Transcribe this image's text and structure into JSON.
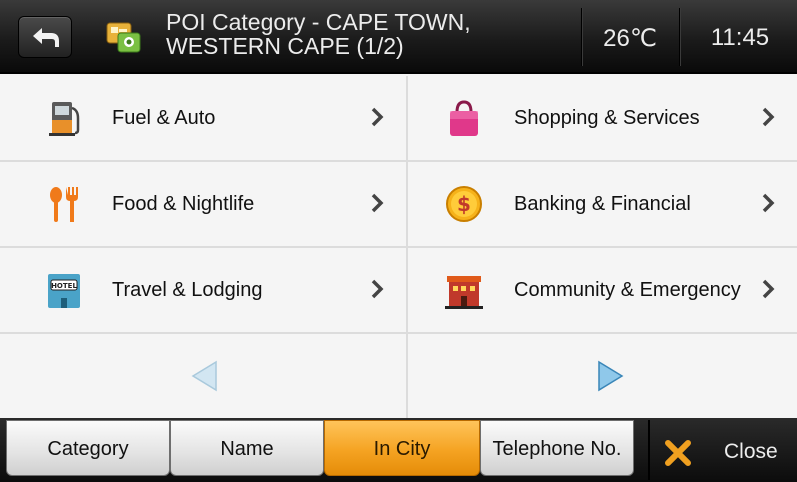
{
  "header": {
    "title_line1": "POI Category - CAPE TOWN,",
    "title_line2": "WESTERN CAPE (1/2)",
    "temperature": "26℃",
    "time": "11:45"
  },
  "categories": [
    {
      "label": "Fuel & Auto",
      "icon": "fuel-pump-icon"
    },
    {
      "label": "Shopping & Services",
      "icon": "shopping-bag-icon"
    },
    {
      "label": "Food & Nightlife",
      "icon": "fork-spoon-icon"
    },
    {
      "label": "Banking & Financial",
      "icon": "dollar-coin-icon"
    },
    {
      "label": "Travel & Lodging",
      "icon": "hotel-icon"
    },
    {
      "label": "Community & Emergency",
      "icon": "building-icon"
    }
  ],
  "tabs": [
    {
      "label": "Category",
      "active": false
    },
    {
      "label": "Name",
      "active": false
    },
    {
      "label": "In City",
      "active": true
    },
    {
      "label": "Telephone No.",
      "active": false
    }
  ],
  "close_label": "Close",
  "colors": {
    "accent": "#f5a322",
    "header_bg": "#1b1b1b",
    "nav_arrow": "#8fc8ea"
  }
}
